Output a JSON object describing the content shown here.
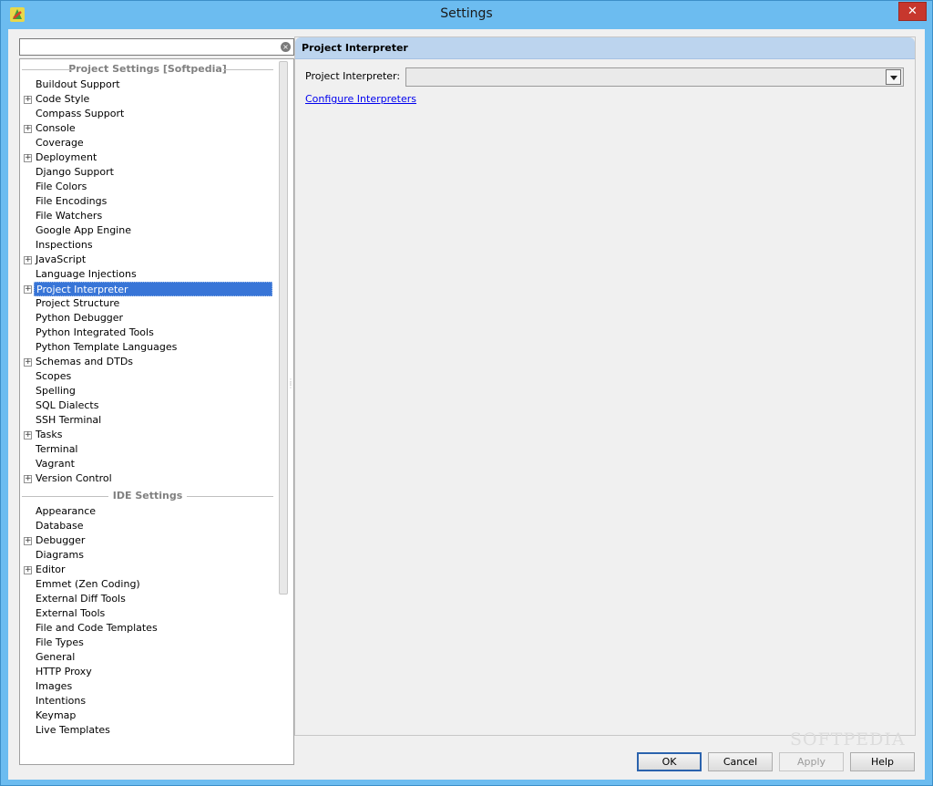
{
  "window": {
    "title": "Settings",
    "close_label": "✕"
  },
  "search": {
    "value": "",
    "clear_icon": "×"
  },
  "tree": {
    "project_group": "Project Settings [Softpedia]",
    "project_items": [
      {
        "label": "Buildout Support",
        "expandable": false
      },
      {
        "label": "Code Style",
        "expandable": true
      },
      {
        "label": "Compass Support",
        "expandable": false
      },
      {
        "label": "Console",
        "expandable": true
      },
      {
        "label": "Coverage",
        "expandable": false
      },
      {
        "label": "Deployment",
        "expandable": true
      },
      {
        "label": "Django Support",
        "expandable": false
      },
      {
        "label": "File Colors",
        "expandable": false
      },
      {
        "label": "File Encodings",
        "expandable": false
      },
      {
        "label": "File Watchers",
        "expandable": false
      },
      {
        "label": "Google App Engine",
        "expandable": false
      },
      {
        "label": "Inspections",
        "expandable": false
      },
      {
        "label": "JavaScript",
        "expandable": true
      },
      {
        "label": "Language Injections",
        "expandable": false
      },
      {
        "label": "Project Interpreter",
        "expandable": true,
        "selected": true
      },
      {
        "label": "Project Structure",
        "expandable": false
      },
      {
        "label": "Python Debugger",
        "expandable": false
      },
      {
        "label": "Python Integrated Tools",
        "expandable": false
      },
      {
        "label": "Python Template Languages",
        "expandable": false
      },
      {
        "label": "Schemas and DTDs",
        "expandable": true
      },
      {
        "label": "Scopes",
        "expandable": false
      },
      {
        "label": "Spelling",
        "expandable": false
      },
      {
        "label": "SQL Dialects",
        "expandable": false
      },
      {
        "label": "SSH Terminal",
        "expandable": false
      },
      {
        "label": "Tasks",
        "expandable": true
      },
      {
        "label": "Terminal",
        "expandable": false
      },
      {
        "label": "Vagrant",
        "expandable": false
      },
      {
        "label": "Version Control",
        "expandable": true
      }
    ],
    "ide_group": "IDE Settings",
    "ide_items": [
      {
        "label": "Appearance",
        "expandable": false
      },
      {
        "label": "Database",
        "expandable": false
      },
      {
        "label": "Debugger",
        "expandable": true
      },
      {
        "label": "Diagrams",
        "expandable": false
      },
      {
        "label": "Editor",
        "expandable": true
      },
      {
        "label": "Emmet (Zen Coding)",
        "expandable": false
      },
      {
        "label": "External Diff Tools",
        "expandable": false
      },
      {
        "label": "External Tools",
        "expandable": false
      },
      {
        "label": "File and Code Templates",
        "expandable": false
      },
      {
        "label": "File Types",
        "expandable": false
      },
      {
        "label": "General",
        "expandable": false
      },
      {
        "label": "HTTP Proxy",
        "expandable": false
      },
      {
        "label": "Images",
        "expandable": false
      },
      {
        "label": "Intentions",
        "expandable": false
      },
      {
        "label": "Keymap",
        "expandable": false
      },
      {
        "label": "Live Templates",
        "expandable": false
      }
    ]
  },
  "panel": {
    "header": "Project Interpreter",
    "field_label": "Project Interpreter:",
    "field_value": "",
    "link": "Configure Interpreters"
  },
  "buttons": {
    "ok": "OK",
    "cancel": "Cancel",
    "apply": "Apply",
    "help": "Help"
  },
  "watermark": "SOFTPEDIA",
  "colors": {
    "title_bar": "#6cbcf0",
    "selection": "#3875d7",
    "panel_header": "#bcd4ee",
    "close_button": "#c7372d"
  }
}
